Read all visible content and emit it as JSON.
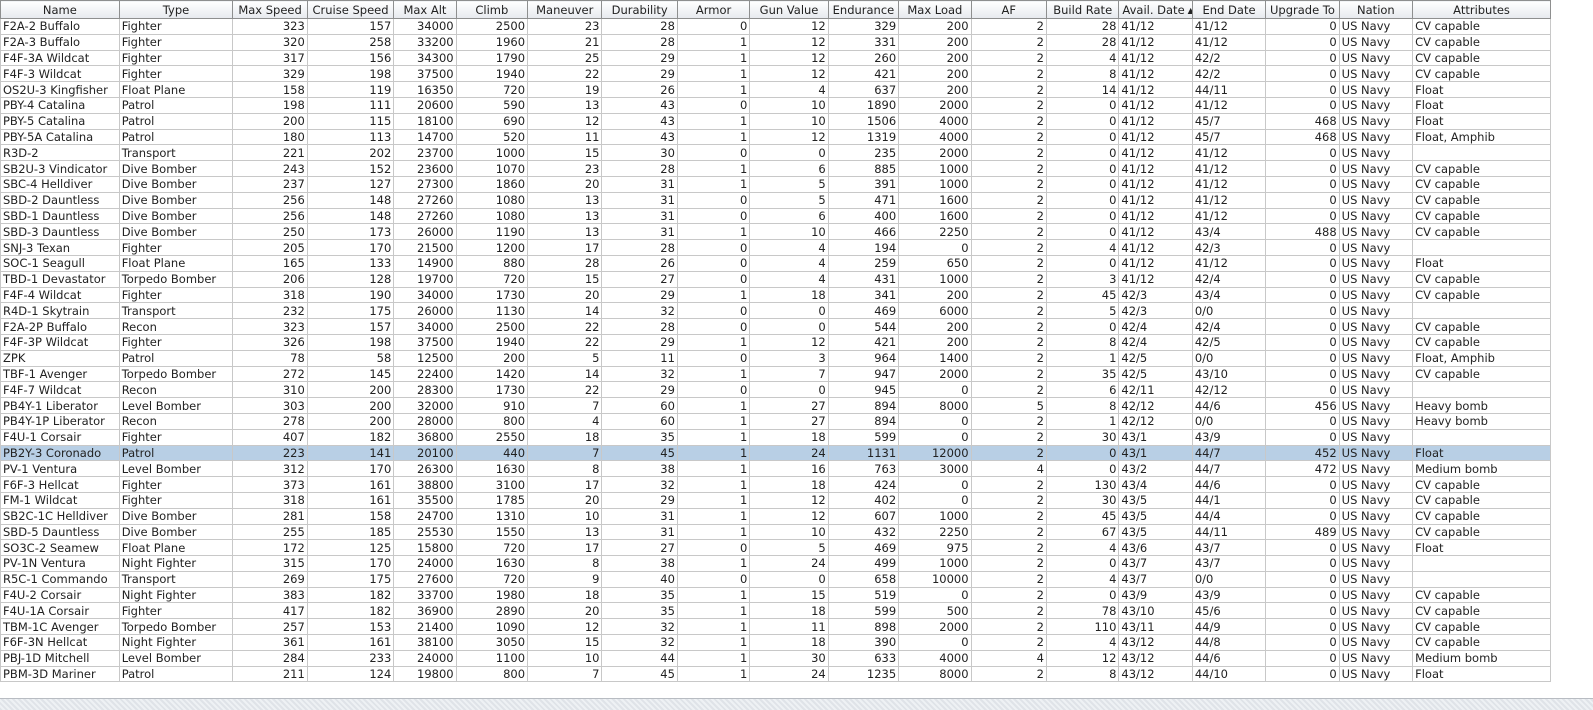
{
  "table": {
    "columns": [
      {
        "label": "Name",
        "width": 118,
        "align": "txt"
      },
      {
        "label": "Type",
        "width": 113,
        "align": "txt"
      },
      {
        "label": "Max Speed",
        "width": 74,
        "align": "num"
      },
      {
        "label": "Cruise Speed",
        "width": 86,
        "align": "num"
      },
      {
        "label": "Max Alt",
        "width": 62,
        "align": "num"
      },
      {
        "label": "Climb",
        "width": 71,
        "align": "num"
      },
      {
        "label": "Maneuver",
        "width": 74,
        "align": "num"
      },
      {
        "label": "Durability",
        "width": 75,
        "align": "num"
      },
      {
        "label": "Armor",
        "width": 72,
        "align": "num"
      },
      {
        "label": "Gun Value",
        "width": 78,
        "align": "num"
      },
      {
        "label": "Endurance",
        "width": 70,
        "align": "num"
      },
      {
        "label": "Max Load",
        "width": 72,
        "align": "num"
      },
      {
        "label": "AF",
        "width": 75,
        "align": "num"
      },
      {
        "label": "Build Rate",
        "width": 72,
        "align": "num"
      },
      {
        "label": "Avail. Date",
        "width": 73,
        "align": "txt",
        "sort_indicator": "▲"
      },
      {
        "label": "End Date",
        "width": 73,
        "align": "txt"
      },
      {
        "label": "Upgrade To",
        "width": 73,
        "align": "num"
      },
      {
        "label": "Nation",
        "width": 73,
        "align": "txt"
      },
      {
        "label": "Attributes",
        "width": 137,
        "align": "txt"
      }
    ],
    "selected_row_index": 27,
    "rows": [
      [
        "F2A-2 Buffalo",
        "Fighter",
        "323",
        "157",
        "34000",
        "2500",
        "23",
        "28",
        "0",
        "12",
        "329",
        "200",
        "2",
        "28",
        "41/12",
        "41/12",
        "0",
        "US Navy",
        "CV capable"
      ],
      [
        "F2A-3 Buffalo",
        "Fighter",
        "320",
        "258",
        "33200",
        "1960",
        "21",
        "28",
        "1",
        "12",
        "331",
        "200",
        "2",
        "28",
        "41/12",
        "41/12",
        "0",
        "US Navy",
        "CV capable"
      ],
      [
        "F4F-3A Wildcat",
        "Fighter",
        "317",
        "156",
        "34300",
        "1790",
        "25",
        "29",
        "1",
        "12",
        "260",
        "200",
        "2",
        "4",
        "41/12",
        "42/2",
        "0",
        "US Navy",
        "CV capable"
      ],
      [
        "F4F-3 Wildcat",
        "Fighter",
        "329",
        "198",
        "37500",
        "1940",
        "22",
        "29",
        "1",
        "12",
        "421",
        "200",
        "2",
        "8",
        "41/12",
        "42/2",
        "0",
        "US Navy",
        "CV capable"
      ],
      [
        "OS2U-3 Kingfisher",
        "Float Plane",
        "158",
        "119",
        "16350",
        "720",
        "19",
        "26",
        "1",
        "4",
        "637",
        "200",
        "2",
        "14",
        "41/12",
        "44/11",
        "0",
        "US Navy",
        "Float"
      ],
      [
        "PBY-4 Catalina",
        "Patrol",
        "198",
        "111",
        "20600",
        "590",
        "13",
        "43",
        "0",
        "10",
        "1890",
        "2000",
        "2",
        "0",
        "41/12",
        "41/12",
        "0",
        "US Navy",
        "Float"
      ],
      [
        "PBY-5 Catalina",
        "Patrol",
        "200",
        "115",
        "18100",
        "690",
        "12",
        "43",
        "1",
        "10",
        "1506",
        "4000",
        "2",
        "0",
        "41/12",
        "45/7",
        "468",
        "US Navy",
        "Float"
      ],
      [
        "PBY-5A Catalina",
        "Patrol",
        "180",
        "113",
        "14700",
        "520",
        "11",
        "43",
        "1",
        "12",
        "1319",
        "4000",
        "2",
        "0",
        "41/12",
        "45/7",
        "468",
        "US Navy",
        "Float, Amphib"
      ],
      [
        "R3D-2",
        "Transport",
        "221",
        "202",
        "23700",
        "1000",
        "15",
        "30",
        "0",
        "0",
        "235",
        "2000",
        "2",
        "0",
        "41/12",
        "41/12",
        "0",
        "US Navy",
        ""
      ],
      [
        "SB2U-3 Vindicator",
        "Dive Bomber",
        "243",
        "152",
        "23600",
        "1070",
        "23",
        "28",
        "1",
        "6",
        "885",
        "1000",
        "2",
        "0",
        "41/12",
        "41/12",
        "0",
        "US Navy",
        "CV capable"
      ],
      [
        "SBC-4 Helldiver",
        "Dive Bomber",
        "237",
        "127",
        "27300",
        "1860",
        "20",
        "31",
        "1",
        "5",
        "391",
        "1000",
        "2",
        "0",
        "41/12",
        "41/12",
        "0",
        "US Navy",
        "CV capable"
      ],
      [
        "SBD-2 Dauntless",
        "Dive Bomber",
        "256",
        "148",
        "27260",
        "1080",
        "13",
        "31",
        "0",
        "5",
        "471",
        "1600",
        "2",
        "0",
        "41/12",
        "41/12",
        "0",
        "US Navy",
        "CV capable"
      ],
      [
        "SBD-1 Dauntless",
        "Dive Bomber",
        "256",
        "148",
        "27260",
        "1080",
        "13",
        "31",
        "0",
        "6",
        "400",
        "1600",
        "2",
        "0",
        "41/12",
        "41/12",
        "0",
        "US Navy",
        "CV capable"
      ],
      [
        "SBD-3 Dauntless",
        "Dive Bomber",
        "250",
        "173",
        "26000",
        "1190",
        "13",
        "31",
        "1",
        "10",
        "466",
        "2250",
        "2",
        "0",
        "41/12",
        "43/4",
        "488",
        "US Navy",
        "CV capable"
      ],
      [
        "SNJ-3 Texan",
        "Fighter",
        "205",
        "170",
        "21500",
        "1200",
        "17",
        "28",
        "0",
        "4",
        "194",
        "0",
        "2",
        "4",
        "41/12",
        "42/3",
        "0",
        "US Navy",
        ""
      ],
      [
        "SOC-1 Seagull",
        "Float Plane",
        "165",
        "133",
        "14900",
        "880",
        "28",
        "26",
        "0",
        "4",
        "259",
        "650",
        "2",
        "0",
        "41/12",
        "41/12",
        "0",
        "US Navy",
        "Float"
      ],
      [
        "TBD-1 Devastator",
        "Torpedo Bomber",
        "206",
        "128",
        "19700",
        "720",
        "15",
        "27",
        "0",
        "4",
        "431",
        "1000",
        "2",
        "3",
        "41/12",
        "42/4",
        "0",
        "US Navy",
        "CV capable"
      ],
      [
        "F4F-4 Wildcat",
        "Fighter",
        "318",
        "190",
        "34000",
        "1730",
        "20",
        "29",
        "1",
        "18",
        "341",
        "200",
        "2",
        "45",
        "42/3",
        "43/4",
        "0",
        "US Navy",
        "CV capable"
      ],
      [
        "R4D-1 Skytrain",
        "Transport",
        "232",
        "175",
        "26000",
        "1130",
        "14",
        "32",
        "0",
        "0",
        "469",
        "6000",
        "2",
        "5",
        "42/3",
        "0/0",
        "0",
        "US Navy",
        ""
      ],
      [
        "F2A-2P Buffalo",
        "Recon",
        "323",
        "157",
        "34000",
        "2500",
        "22",
        "28",
        "0",
        "0",
        "544",
        "200",
        "2",
        "0",
        "42/4",
        "42/4",
        "0",
        "US Navy",
        "CV capable"
      ],
      [
        "F4F-3P Wildcat",
        "Fighter",
        "326",
        "198",
        "37500",
        "1940",
        "22",
        "29",
        "1",
        "12",
        "421",
        "200",
        "2",
        "8",
        "42/4",
        "42/5",
        "0",
        "US Navy",
        "CV capable"
      ],
      [
        "ZPK",
        "Patrol",
        "78",
        "58",
        "12500",
        "200",
        "5",
        "11",
        "0",
        "3",
        "964",
        "1400",
        "2",
        "1",
        "42/5",
        "0/0",
        "0",
        "US Navy",
        "Float, Amphib"
      ],
      [
        "TBF-1 Avenger",
        "Torpedo Bomber",
        "272",
        "145",
        "22400",
        "1420",
        "14",
        "32",
        "1",
        "7",
        "947",
        "2000",
        "2",
        "35",
        "42/5",
        "43/10",
        "0",
        "US Navy",
        "CV capable"
      ],
      [
        "F4F-7 Wildcat",
        "Recon",
        "310",
        "200",
        "28300",
        "1730",
        "22",
        "29",
        "0",
        "0",
        "945",
        "0",
        "2",
        "6",
        "42/11",
        "42/12",
        "0",
        "US Navy",
        ""
      ],
      [
        "PB4Y-1 Liberator",
        "Level Bomber",
        "303",
        "200",
        "32000",
        "910",
        "7",
        "60",
        "1",
        "27",
        "894",
        "8000",
        "5",
        "8",
        "42/12",
        "44/6",
        "456",
        "US Navy",
        "Heavy bomb"
      ],
      [
        "PB4Y-1P Liberator",
        "Recon",
        "278",
        "200",
        "28000",
        "800",
        "4",
        "60",
        "1",
        "27",
        "894",
        "0",
        "2",
        "1",
        "42/12",
        "0/0",
        "0",
        "US Navy",
        "Heavy bomb"
      ],
      [
        "F4U-1 Corsair",
        "Fighter",
        "407",
        "182",
        "36800",
        "2550",
        "18",
        "35",
        "1",
        "18",
        "599",
        "0",
        "2",
        "30",
        "43/1",
        "43/9",
        "0",
        "US Navy",
        ""
      ],
      [
        "PB2Y-3 Coronado",
        "Patrol",
        "223",
        "141",
        "20100",
        "440",
        "7",
        "45",
        "1",
        "24",
        "1131",
        "12000",
        "2",
        "0",
        "43/1",
        "44/7",
        "452",
        "US Navy",
        "Float"
      ],
      [
        "PV-1 Ventura",
        "Level Bomber",
        "312",
        "170",
        "26300",
        "1630",
        "8",
        "38",
        "1",
        "16",
        "763",
        "3000",
        "4",
        "0",
        "43/2",
        "44/7",
        "472",
        "US Navy",
        "Medium bomb"
      ],
      [
        "F6F-3 Hellcat",
        "Fighter",
        "373",
        "161",
        "38800",
        "3100",
        "17",
        "32",
        "1",
        "18",
        "424",
        "0",
        "2",
        "130",
        "43/4",
        "44/6",
        "0",
        "US Navy",
        "CV capable"
      ],
      [
        "FM-1 Wildcat",
        "Fighter",
        "318",
        "161",
        "35500",
        "1785",
        "20",
        "29",
        "1",
        "12",
        "402",
        "0",
        "2",
        "30",
        "43/5",
        "44/1",
        "0",
        "US Navy",
        "CV capable"
      ],
      [
        "SB2C-1C Helldiver",
        "Dive Bomber",
        "281",
        "158",
        "24700",
        "1310",
        "10",
        "31",
        "1",
        "12",
        "607",
        "1000",
        "2",
        "45",
        "43/5",
        "44/4",
        "0",
        "US Navy",
        "CV capable"
      ],
      [
        "SBD-5 Dauntless",
        "Dive Bomber",
        "255",
        "185",
        "25530",
        "1550",
        "13",
        "31",
        "1",
        "10",
        "432",
        "2250",
        "2",
        "67",
        "43/5",
        "44/11",
        "489",
        "US Navy",
        "CV capable"
      ],
      [
        "SO3C-2 Seamew",
        "Float Plane",
        "172",
        "125",
        "15800",
        "720",
        "17",
        "27",
        "0",
        "5",
        "469",
        "975",
        "2",
        "4",
        "43/6",
        "43/7",
        "0",
        "US Navy",
        "Float"
      ],
      [
        "PV-1N Ventura",
        "Night Fighter",
        "315",
        "170",
        "24000",
        "1630",
        "8",
        "38",
        "1",
        "24",
        "499",
        "1000",
        "2",
        "0",
        "43/7",
        "43/7",
        "0",
        "US Navy",
        ""
      ],
      [
        "R5C-1 Commando",
        "Transport",
        "269",
        "175",
        "27600",
        "720",
        "9",
        "40",
        "0",
        "0",
        "658",
        "10000",
        "2",
        "4",
        "43/7",
        "0/0",
        "0",
        "US Navy",
        ""
      ],
      [
        "F4U-2 Corsair",
        "Night Fighter",
        "383",
        "182",
        "33700",
        "1980",
        "18",
        "35",
        "1",
        "15",
        "519",
        "0",
        "2",
        "0",
        "43/9",
        "43/9",
        "0",
        "US Navy",
        "CV capable"
      ],
      [
        "F4U-1A Corsair",
        "Fighter",
        "417",
        "182",
        "36900",
        "2890",
        "20",
        "35",
        "1",
        "18",
        "599",
        "500",
        "2",
        "78",
        "43/10",
        "45/6",
        "0",
        "US Navy",
        "CV capable"
      ],
      [
        "TBM-1C Avenger",
        "Torpedo Bomber",
        "257",
        "153",
        "21400",
        "1090",
        "12",
        "32",
        "1",
        "11",
        "898",
        "2000",
        "2",
        "110",
        "43/11",
        "44/9",
        "0",
        "US Navy",
        "CV capable"
      ],
      [
        "F6F-3N Hellcat",
        "Night Fighter",
        "361",
        "161",
        "38100",
        "3050",
        "15",
        "32",
        "1",
        "18",
        "390",
        "0",
        "2",
        "4",
        "43/12",
        "44/8",
        "0",
        "US Navy",
        "CV capable"
      ],
      [
        "PBJ-1D Mitchell",
        "Level Bomber",
        "284",
        "233",
        "24000",
        "1100",
        "10",
        "44",
        "1",
        "30",
        "633",
        "4000",
        "4",
        "12",
        "43/12",
        "44/6",
        "0",
        "US Navy",
        "Medium bomb"
      ],
      [
        "PBM-3D Mariner",
        "Patrol",
        "211",
        "124",
        "19800",
        "800",
        "7",
        "45",
        "1",
        "24",
        "1235",
        "8000",
        "2",
        "8",
        "43/12",
        "44/10",
        "0",
        "US Navy",
        "Float"
      ]
    ]
  }
}
